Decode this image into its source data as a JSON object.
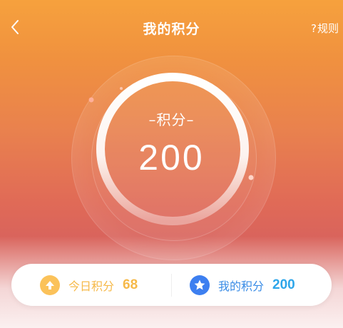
{
  "header": {
    "title": "我的积分",
    "rules_label": "规则",
    "rules_prefix": "?"
  },
  "points": {
    "label": "–积分–",
    "value": "200"
  },
  "summary": {
    "today_label": "今日积分",
    "today_value": "68",
    "mine_label": "我的积分",
    "mine_value": "200"
  },
  "colors": {
    "accent_orange": "#f6a13d",
    "accent_red": "#d9645c",
    "today_color": "#f6b949",
    "mine_color": "#2ea6ea"
  },
  "icons": [
    "back-chevron-icon",
    "arrow-up-icon",
    "star-icon"
  ]
}
